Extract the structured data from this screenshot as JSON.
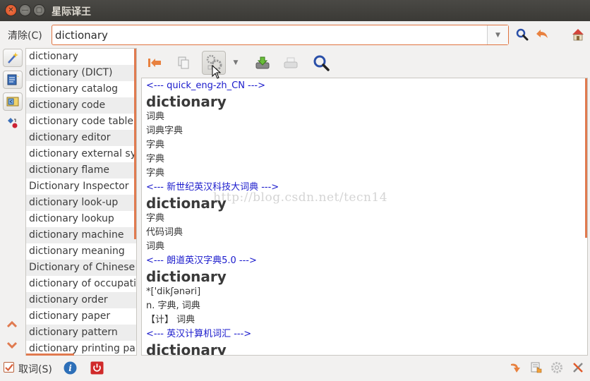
{
  "window": {
    "title": "星际译王",
    "controls": [
      "close",
      "minimize",
      "maximize"
    ]
  },
  "search": {
    "clear_label": "清除(C)",
    "value": "dictionary",
    "buttons": [
      "search-icon",
      "back-icon",
      "home-icon"
    ]
  },
  "sidebar": {
    "buttons": [
      "wand-icon",
      "document-edit-icon",
      "dict-manager-icon",
      "fuzzy-query-icon"
    ],
    "nav": [
      "chevron-up-icon",
      "chevron-down-icon"
    ]
  },
  "word_list": [
    "dictionary",
    "dictionary (DICT)",
    "dictionary catalog",
    "dictionary code",
    "dictionary code table",
    "dictionary editor",
    "dictionary external symbol",
    "dictionary flame",
    "Dictionary Inspector",
    "dictionary look-up",
    "dictionary lookup",
    "dictionary machine",
    "dictionary meaning",
    "Dictionary of Chinese P",
    "dictionary of occupatio",
    "dictionary order",
    "dictionary paper",
    "dictionary pattern",
    "dictionary printing pap"
  ],
  "toolbar": {
    "items": [
      "jump-to-first-icon",
      "copy-icon",
      "settings-gears-icon",
      "dropdown-arrow-icon",
      "save-icon",
      "print-icon",
      "find-icon"
    ]
  },
  "definitions": [
    {
      "dict": "<--- quick_eng-zh_CN --->",
      "word": "dictionary",
      "lines": [
        "词典",
        "词典字典",
        "字典",
        "字典",
        "字典"
      ]
    },
    {
      "dict": "<--- 新世纪英汉科技大词典 --->",
      "word": "dictionary",
      "lines": [
        "字典",
        "代码词典",
        "词典"
      ]
    },
    {
      "dict": "<--- 朗道英汉字典5.0 --->",
      "word": "dictionary",
      "lines": [
        "*['dikʃənəri]",
        "n. 字典, 词典",
        "【计】 词典"
      ]
    },
    {
      "dict": "<--- 英汉计算机词汇 --->",
      "word": "dictionary",
      "lines": []
    }
  ],
  "watermark": "http://blog.csdn.net/tecn14",
  "bottom": {
    "scan_label": "取词(S)",
    "scan_checked": true,
    "left_icons": [
      "info-icon",
      "power-icon"
    ],
    "right_icons": [
      "redirect-icon",
      "manual-icon",
      "preferences-gear-icon",
      "tools-icon"
    ]
  },
  "colors": {
    "accent": "#e07a4f",
    "dict_header": "#1a1acc",
    "titlebar": "#3b3a36"
  }
}
